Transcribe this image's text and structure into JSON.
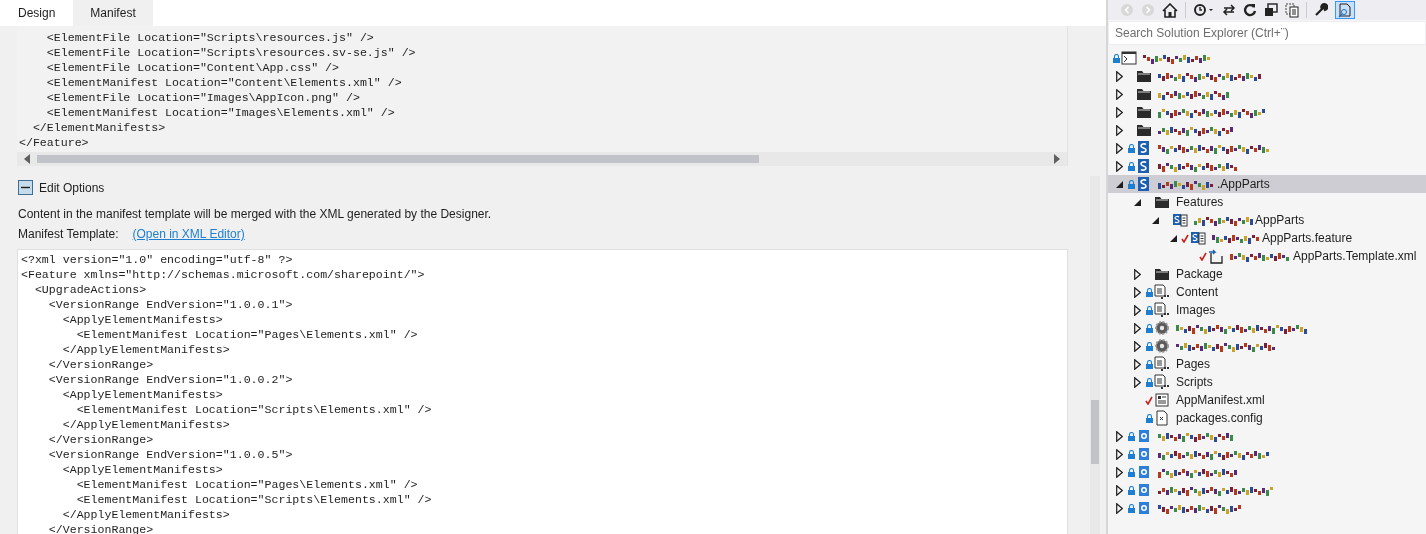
{
  "editor_tabs": [
    {
      "label": "Design",
      "selected": false
    },
    {
      "label": "Manifest",
      "selected": true
    }
  ],
  "generated_manifest": {
    "lines": [
      "    <ElementFile Location=\"Scripts\\resources.js\" />",
      "    <ElementFile Location=\"Scripts\\resources.sv-se.js\" />",
      "    <ElementFile Location=\"Content\\App.css\" />",
      "    <ElementManifest Location=\"Content\\Elements.xml\" />",
      "    <ElementFile Location=\"Images\\AppIcon.png\" />",
      "    <ElementManifest Location=\"Images\\Elements.xml\" />",
      "  </ElementManifests>",
      "</Feature>"
    ]
  },
  "edit_options": {
    "label": "Edit Options",
    "expanded": true,
    "description": "Content in the manifest template will be merged with the XML generated by the Designer.",
    "template_label": "Manifest Template:",
    "template_link": "(Open in XML Editor)"
  },
  "manifest_template": {
    "lines": [
      "<?xml version=\"1.0\" encoding=\"utf-8\" ?>",
      "<Feature xmlns=\"http://schemas.microsoft.com/sharepoint/\">",
      "  <UpgradeActions>",
      "    <VersionRange EndVersion=\"1.0.0.1\">",
      "      <ApplyElementManifests>",
      "        <ElementManifest Location=\"Pages\\Elements.xml\" />",
      "      </ApplyElementManifests>",
      "    </VersionRange>",
      "    <VersionRange EndVersion=\"1.0.0.2\">",
      "      <ApplyElementManifests>",
      "        <ElementManifest Location=\"Scripts\\Elements.xml\" />",
      "      </ApplyElementManifests>",
      "    </VersionRange>",
      "    <VersionRange EndVersion=\"1.0.0.5\">",
      "      <ApplyElementManifests>",
      "        <ElementManifest Location=\"Pages\\Elements.xml\" />",
      "        <ElementManifest Location=\"Scripts\\Elements.xml\" />",
      "      </ApplyElementManifests>",
      "    </VersionRange>"
    ]
  },
  "solution_explorer": {
    "search": {
      "placeholder": "Search Solution Explorer (Ctrl+¨)"
    },
    "tree": [
      {
        "kind": "solution",
        "redacted": true,
        "locked": true,
        "pending": false,
        "selected": false,
        "children": [
          {
            "kind": "folder",
            "redacted": true,
            "locked": false,
            "pending": false,
            "selected": false,
            "expanded": false
          },
          {
            "kind": "folder",
            "redacted": true,
            "locked": false,
            "pending": false,
            "selected": false,
            "expanded": false
          },
          {
            "kind": "folder",
            "redacted": true,
            "locked": false,
            "pending": false,
            "selected": false,
            "expanded": false
          },
          {
            "kind": "folder",
            "redacted": true,
            "locked": false,
            "pending": false,
            "selected": false,
            "expanded": false
          },
          {
            "kind": "sp-project",
            "redacted": true,
            "locked": true,
            "pending": false,
            "selected": false,
            "expanded": false
          },
          {
            "kind": "sp-project",
            "redacted": true,
            "locked": true,
            "pending": false,
            "selected": false,
            "expanded": false
          },
          {
            "kind": "sp-project",
            "redacted": true,
            "label": ".AppParts",
            "locked": true,
            "pending": false,
            "selected": true,
            "expanded": true,
            "children": [
              {
                "kind": "folder",
                "label": "Features",
                "locked": false,
                "pending": false,
                "selected": false,
                "expanded": true,
                "children": [
                  {
                    "kind": "feature",
                    "redacted": true,
                    "label": "AppParts",
                    "locked": false,
                    "pending": false,
                    "selected": false,
                    "expanded": true,
                    "children": [
                      {
                        "kind": "feature",
                        "redacted": true,
                        "label": "AppParts.feature",
                        "pending": true,
                        "selected": false,
                        "expanded": true,
                        "children": [
                          {
                            "kind": "template",
                            "redacted": true,
                            "label": "AppParts.Template.xml",
                            "pending": true,
                            "selected": false
                          }
                        ]
                      }
                    ]
                  }
                ]
              },
              {
                "kind": "folder",
                "label": "Package",
                "locked": false,
                "pending": false,
                "selected": false,
                "expanded": false
              },
              {
                "kind": "module",
                "label": "Content",
                "locked": true,
                "pending": false,
                "selected": false,
                "expanded": false
              },
              {
                "kind": "module",
                "label": "Images",
                "locked": true,
                "pending": false,
                "selected": false,
                "expanded": false
              },
              {
                "kind": "webpart",
                "redacted": true,
                "locked": true,
                "pending": false,
                "selected": false,
                "expanded": false
              },
              {
                "kind": "webpart",
                "redacted": true,
                "locked": true,
                "pending": false,
                "selected": false,
                "expanded": false
              },
              {
                "kind": "module",
                "label": "Pages",
                "locked": true,
                "pending": false,
                "selected": false,
                "expanded": false
              },
              {
                "kind": "module",
                "label": "Scripts",
                "locked": true,
                "pending": false,
                "selected": false,
                "expanded": false
              },
              {
                "kind": "manifest",
                "label": "AppManifest.xml",
                "pending": true,
                "selected": false
              },
              {
                "kind": "config",
                "label": "packages.config",
                "locked": true,
                "pending": false,
                "selected": false
              }
            ]
          },
          {
            "kind": "app-project",
            "redacted": true,
            "locked": true,
            "pending": false,
            "selected": false,
            "expanded": false
          },
          {
            "kind": "app-project",
            "redacted": true,
            "locked": true,
            "pending": false,
            "selected": false,
            "expanded": false
          },
          {
            "kind": "app-project",
            "redacted": true,
            "locked": true,
            "pending": false,
            "selected": false,
            "expanded": false
          },
          {
            "kind": "app-project",
            "redacted": true,
            "locked": true,
            "pending": false,
            "selected": false,
            "expanded": false
          },
          {
            "kind": "app-project",
            "redacted": true,
            "locked": true,
            "pending": false,
            "selected": false,
            "expanded": false
          }
        ]
      }
    ]
  }
}
